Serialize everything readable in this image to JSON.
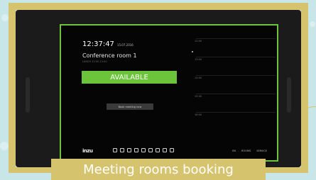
{
  "clock": {
    "time": "12:37:47",
    "date": "15.07.2016"
  },
  "room": {
    "name": "Conference room 1",
    "subtitle": "LUNCH 12:00-13:00"
  },
  "status": {
    "label": "AVAILABLE",
    "color": "#6cc43a"
  },
  "book_button": {
    "label": "Book meeting now"
  },
  "timeline": {
    "hours": [
      "12:00",
      "13:00",
      "14:00",
      "15:00",
      "16:00"
    ]
  },
  "footer": {
    "logo": "inzu",
    "links": [
      "EN",
      "ROOMS",
      "SERVICE"
    ]
  },
  "banner": {
    "caption": "Meeting rooms booking"
  },
  "colors": {
    "frame": "#d6c36e",
    "accent": "#6cc43a",
    "background": "#c8e6e8"
  }
}
